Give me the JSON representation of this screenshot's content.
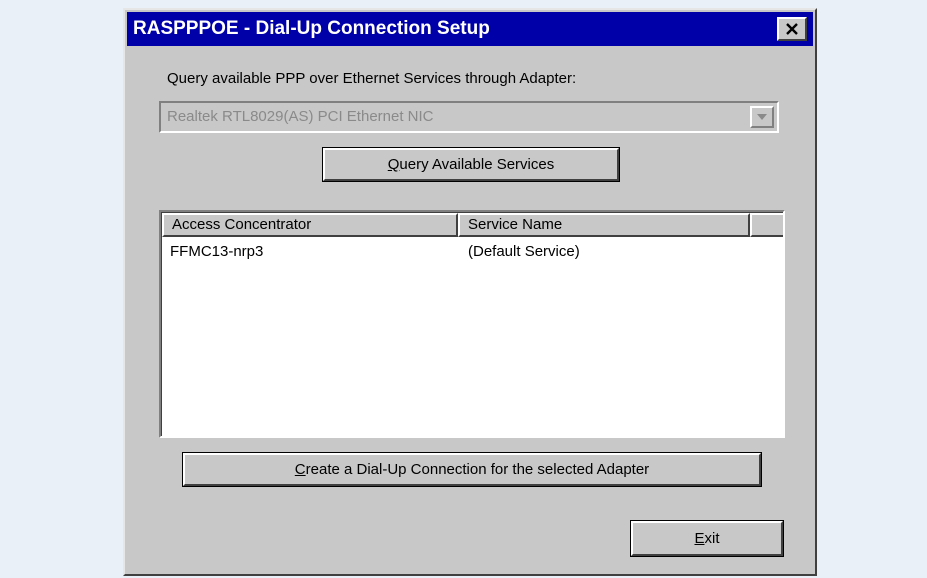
{
  "window": {
    "title": "RASPPPOE - Dial-Up Connection Setup",
    "close_label": "×"
  },
  "query_label": "Query available PPP over Ethernet Services through Adapter:",
  "adapter_select": {
    "selected": "Realtek RTL8029(AS) PCI Ethernet NIC"
  },
  "query_button": {
    "mnemonic": "Q",
    "rest": "uery Available Services"
  },
  "services_list": {
    "columns": [
      "Access Concentrator",
      "Service Name"
    ],
    "rows": [
      {
        "access_concentrator": "FFMC13-nrp3",
        "service_name": "(Default Service)"
      }
    ]
  },
  "create_button": {
    "mnemonic": "C",
    "rest": "reate a Dial-Up Connection for the selected Adapter"
  },
  "exit_button": {
    "mnemonic": "E",
    "rest": "xit"
  }
}
